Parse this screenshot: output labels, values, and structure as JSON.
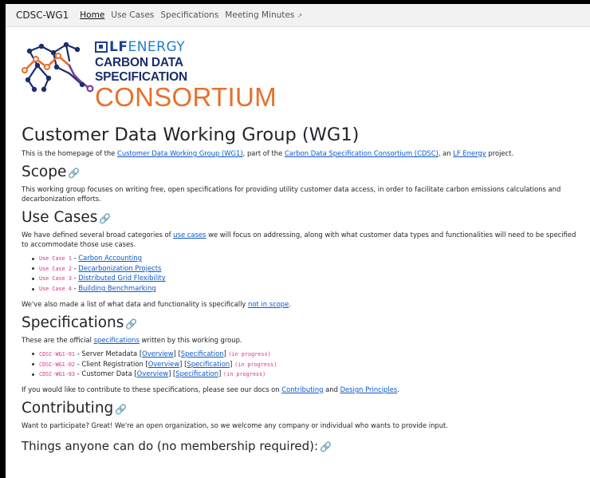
{
  "nav": {
    "brand": "CDSC-WG1",
    "items": [
      "Home",
      "Use Cases",
      "Specifications",
      "Meeting Minutes"
    ],
    "external_icon": "↗"
  },
  "logo": {
    "lf": "LF",
    "energy": "ENERGY",
    "line2": "CARBON DATA SPECIFICATION",
    "line3": "CONSORTIUM",
    "colors": {
      "navy": "#1e3f8f",
      "blue": "#1f7fc7",
      "orange": "#e8702a",
      "purple": "#7b3f9e"
    }
  },
  "intro": {
    "title": "Customer Data Working Group (WG1)",
    "p_a": "This is the homepage of the ",
    "link1": "Customer Data Working Group (WG1)",
    "p_b": ", part of the ",
    "link2": "Carbon Data Specification Consortium (CDSC)",
    "p_c": ", an ",
    "link3": "LF Energy",
    "p_d": " project."
  },
  "scope": {
    "title": "Scope",
    "text": "This working group focuses on writing free, open specifications for providing utility customer data access, in order to facilitate carbon emissions calculations and decarbonization efforts."
  },
  "use_cases": {
    "title": "Use Cases",
    "p_a": "We have defined several broad categories of ",
    "link": "use cases",
    "p_b": " we will focus on addressing, along with what customer data types and functionalities will need to be specified to accommodate those use cases.",
    "items": [
      {
        "code": "Use Case 1",
        "label": "Carbon Accounting"
      },
      {
        "code": "Use Case 2",
        "label": "Decarbonization Projects"
      },
      {
        "code": "Use Case 3",
        "label": "Distributed Grid Flexibility"
      },
      {
        "code": "Use Case 4",
        "label": "Building Benchmarking"
      }
    ],
    "after_a": "We've also made a list of what data and functionality is specifically ",
    "after_link": "not in scope",
    "after_b": "."
  },
  "specs": {
    "title": "Specifications",
    "p_a": "These are the official ",
    "link": "specifications",
    "p_b": " written by this working group.",
    "items": [
      {
        "code": "CDSC-WG1-01",
        "label": "Server Metadata"
      },
      {
        "code": "CDSC-WG1-02",
        "label": "Client Registration"
      },
      {
        "code": "CDSC-WG1-03",
        "label": "Customer Data"
      }
    ],
    "sep": " - ",
    "overview": "Overview",
    "specification": "Specification",
    "status": "(in progress)",
    "after_a": "If you would like to contribute to these specifications, please see our docs on ",
    "after_link1": "Contributing",
    "after_and": " and ",
    "after_link2": "Design Principles",
    "after_end": "."
  },
  "contributing": {
    "title": "Contributing",
    "text": "Want to participate? Great! We're an open organization, so we welcome any company or individual who wants to provide input."
  },
  "things": {
    "title": "Things anyone can do (no membership required):"
  }
}
